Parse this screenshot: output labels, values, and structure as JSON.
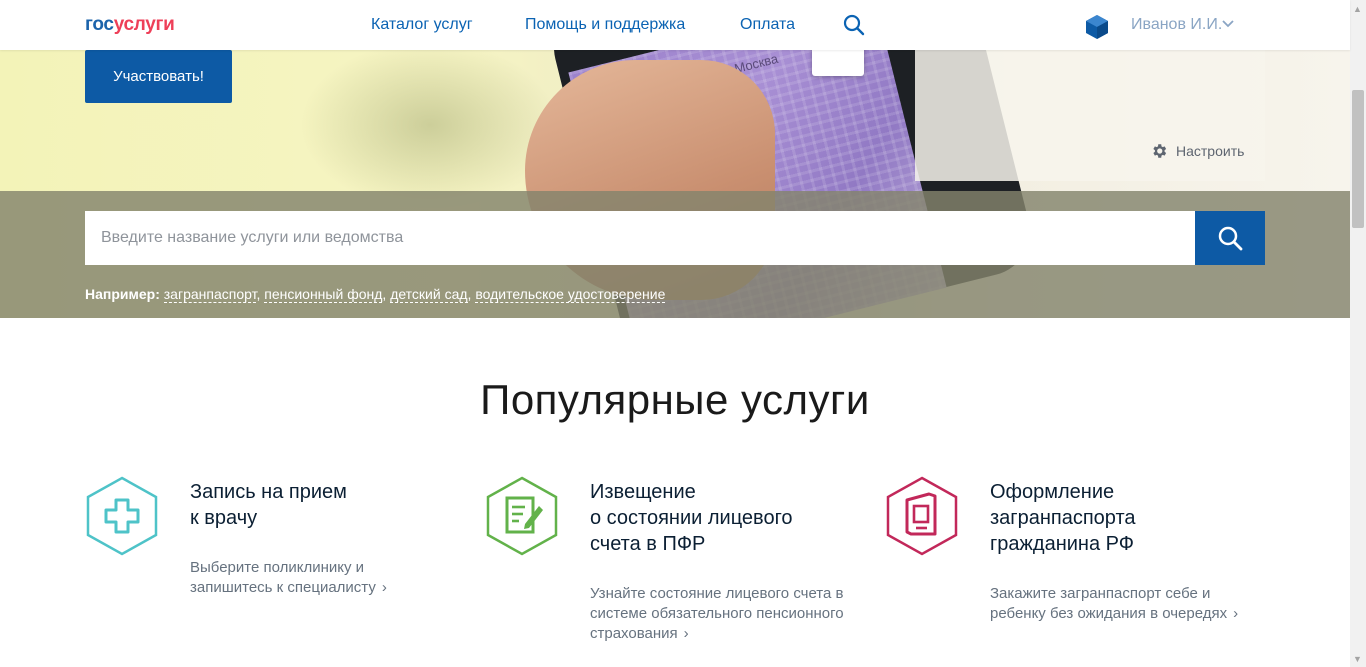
{
  "header": {
    "logo_part1": "гос",
    "logo_part2": "услуги",
    "nav": [
      {
        "label": "Каталог услуг"
      },
      {
        "label": "Помощь и поддержка"
      },
      {
        "label": "Оплата"
      }
    ],
    "user_name": "Иванов И.И."
  },
  "hero": {
    "cta_label": "Участвовать!",
    "map_city": "Москва",
    "settings_label": "Настроить"
  },
  "search": {
    "placeholder": "Введите название услуги или ведомства",
    "examples_label": "Например:",
    "examples": [
      "загранпаспорт",
      "пенсионный фонд",
      "детский сад",
      "водительское удостоверение"
    ]
  },
  "popular": {
    "title": "Популярные услуги",
    "cards": [
      {
        "title_line1": "Запись на прием",
        "title_line2": "к врачу",
        "title_line3": "",
        "desc": "Выберите поликлинику и запишитесь к специалисту",
        "icon": "medical-cross-icon",
        "color": "#4ec3c8"
      },
      {
        "title_line1": "Извещение",
        "title_line2": "о состоянии лицевого",
        "title_line3": "счета в ПФР",
        "desc": "Узнайте состояние лицевого счета в системе обязательного пенсионного страхования",
        "icon": "document-edit-icon",
        "color": "#62b24a"
      },
      {
        "title_line1": "Оформление",
        "title_line2": "загранпаспорта",
        "title_line3": "гражданина РФ",
        "desc": "Закажите загранпаспорт себе и ребенку без ожидания в очередях",
        "icon": "passport-icon",
        "color": "#c2285a"
      }
    ]
  },
  "colors": {
    "brand_blue": "#0d5aa5",
    "link_blue": "#0b63b3",
    "logo_red": "#ee3f58"
  }
}
